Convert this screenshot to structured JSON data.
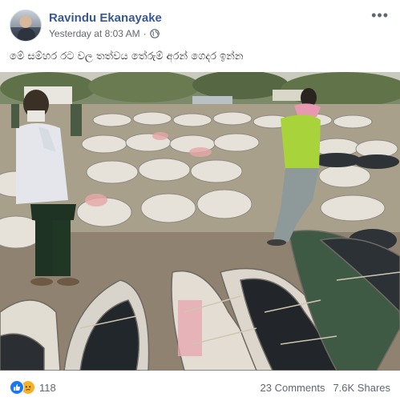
{
  "post": {
    "author": "Ravindu Ekanayake",
    "timestamp": "Yesterday at 8:03 AM",
    "separator": "·",
    "privacy_icon": "globe-icon",
    "more_icon": "more-options-icon",
    "more_glyph": "•••",
    "text": "මේ සම්හර රට වල තත්වය තේරුම් අරන් ගෙදර ඉන්න",
    "image_alt": "Outdoor photo of many bundled bags laid on the ground with people standing nearby"
  },
  "footer": {
    "reaction_icons": [
      "like-icon",
      "sad-icon"
    ],
    "reaction_count": "118",
    "comments": "23 Comments",
    "shares": "7.6K Shares"
  },
  "colors": {
    "author_link": "#385898",
    "meta_text": "#616770",
    "like_blue": "#1877f2",
    "sad_yellow": "#f7b125"
  }
}
